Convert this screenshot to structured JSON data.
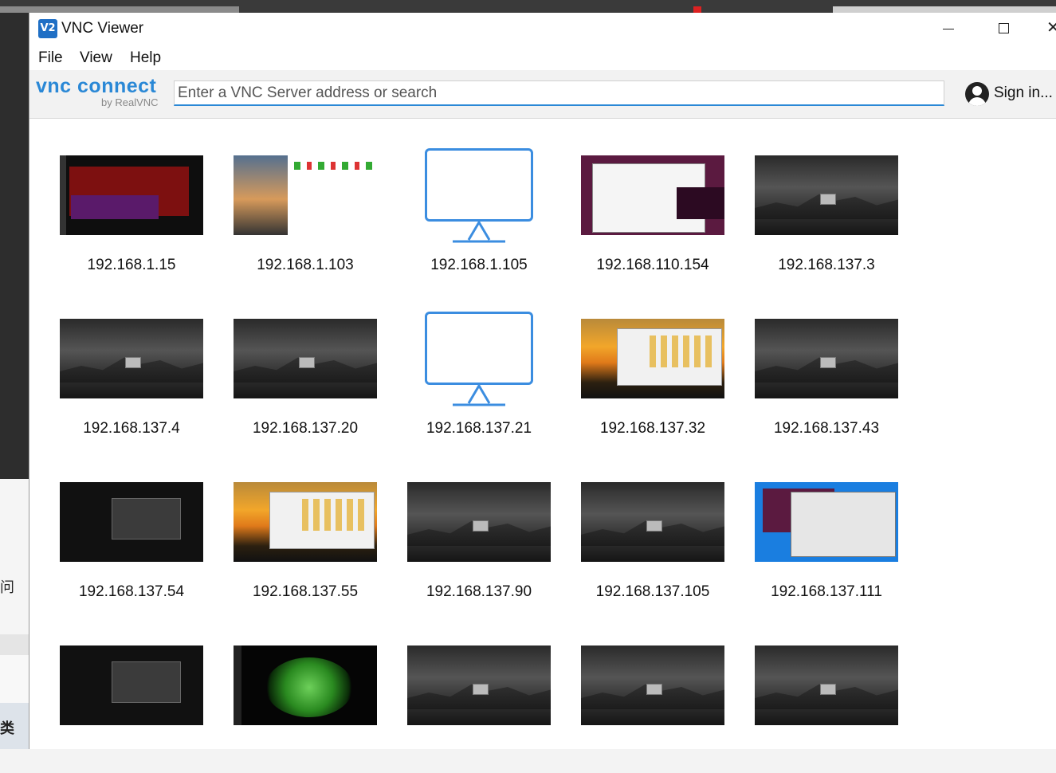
{
  "window": {
    "title": "VNC Viewer",
    "app_icon": "V2"
  },
  "menu": [
    "File",
    "View",
    "Help"
  ],
  "toolbar": {
    "logo": "vnc connect",
    "logo_sub": "by RealVNC",
    "search_placeholder": "Enter a VNC Server address or search",
    "sign_in": "Sign in..."
  },
  "background": {
    "side_char_1": "问",
    "side_char_2": "类"
  },
  "connections": [
    {
      "label": "192.168.1.15",
      "thumb": "term"
    },
    {
      "label": "192.168.1.103",
      "thumb": "code"
    },
    {
      "label": "192.168.1.105",
      "thumb": "monitor"
    },
    {
      "label": "192.168.110.154",
      "thumb": "ubuntu"
    },
    {
      "label": "192.168.137.3",
      "thumb": "dark"
    },
    {
      "label": "192.168.137.4",
      "thumb": "dark"
    },
    {
      "label": "192.168.137.20",
      "thumb": "dark"
    },
    {
      "label": "192.168.137.21",
      "thumb": "monitor"
    },
    {
      "label": "192.168.137.32",
      "thumb": "sun"
    },
    {
      "label": "192.168.137.43",
      "thumb": "dark"
    },
    {
      "label": "192.168.137.54",
      "thumb": "login"
    },
    {
      "label": "192.168.137.55",
      "thumb": "sun"
    },
    {
      "label": "192.168.137.90",
      "thumb": "dark"
    },
    {
      "label": "192.168.137.105",
      "thumb": "dark"
    },
    {
      "label": "192.168.137.111",
      "thumb": "blue"
    },
    {
      "label": "",
      "thumb": "login"
    },
    {
      "label": "",
      "thumb": "nv"
    },
    {
      "label": "",
      "thumb": "dark"
    },
    {
      "label": "",
      "thumb": "dark"
    },
    {
      "label": "",
      "thumb": "dark"
    }
  ]
}
